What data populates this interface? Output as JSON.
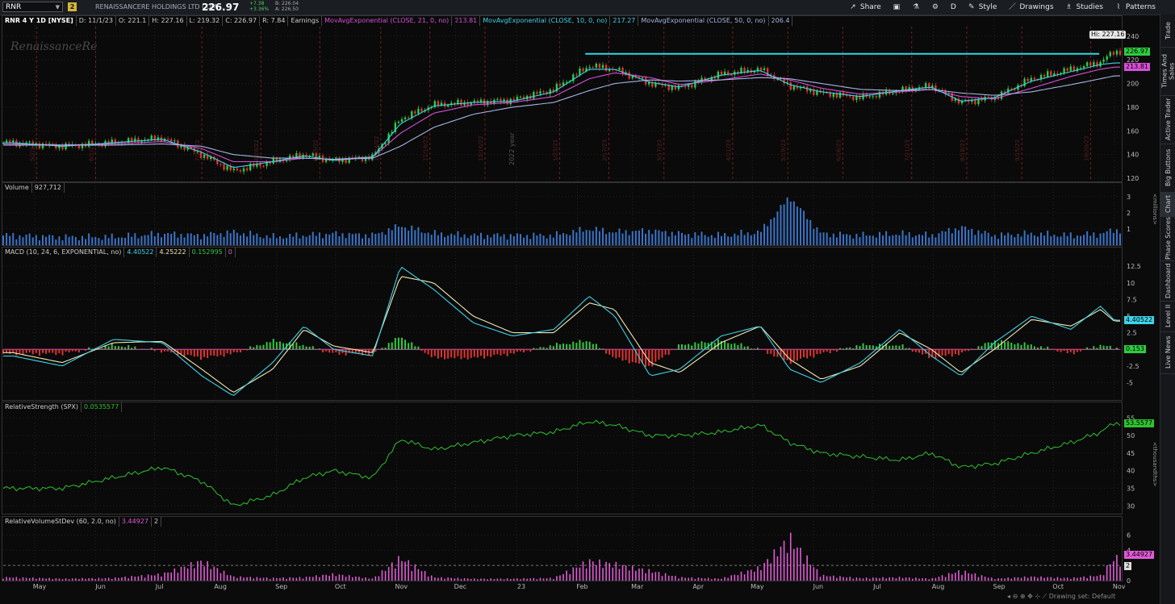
{
  "toolbar": {
    "symbol": "RNR",
    "link_number": "2",
    "company": "RENAISSANCERE HOLDINGS LTD COM",
    "price": "226.97",
    "change": "+7.38",
    "change_pct": "+3.36%",
    "bid": "B: 226.04",
    "ask": "A: 226.50",
    "share": "Share",
    "style": "Style",
    "drawings": "Drawings",
    "studies": "Studies",
    "patterns": "Patterns",
    "interval": "D"
  },
  "sidebar": {
    "tabs": [
      "Trade",
      "Times And Sales",
      "Active Trader",
      "Big Buttons",
      "Chart",
      "Phase Scores",
      "Dashboard",
      "Level II",
      "Live News"
    ]
  },
  "colors": {
    "up": "#2ecc40",
    "down": "#e0342f",
    "ema21": "#d84fd8",
    "ema10": "#3fd3e8",
    "ema50": "#a4b6e6",
    "resistance": "#29d9e6",
    "rs": "#2fc12f",
    "rvsd": "#e05ad6",
    "macd_fast": "#3fd3e8",
    "macd_slow": "#f0e7b0",
    "zero_line": "#e058c8"
  },
  "price_pane": {
    "header": {
      "title": "RNR 4 Y 1D [NYSE]",
      "date": "D: 11/1/23",
      "open": "O: 221.1",
      "high": "H: 227.16",
      "low": "L: 219.32",
      "close": "C: 226.97",
      "range": "R: 7.84",
      "earnings": "Earnings",
      "ema21_label": "MovAvgExponential (CLOSE, 21, 0, no)",
      "ema21_value": "213.81",
      "ema10_label": "MovAvgExponential (CLOSE, 10, 0, no)",
      "ema10_value": "217.27",
      "ema50_label": "MovAvgExponential (CLOSE, 50, 0, no)",
      "ema50_value": "206.4"
    },
    "watermark": "RenaissanceRe",
    "hi_label": "Hi: 227.16",
    "last_badge": "226.97",
    "ema21_badge": "213.81",
    "year_marker": "2022 year",
    "earnings_dates": [
      "5/2/22",
      "6/1/22",
      "7/25/22",
      "8/24/22",
      "9/23/22",
      "10/24/22",
      "11/18/22",
      "12/16/22",
      "1/23/23",
      "2/17/23",
      "3/17/23",
      "4/21/23",
      "5/19/23",
      "6/16/23",
      "7/21/23",
      "8/18/23",
      "9/15/23",
      "10/20/23"
    ]
  },
  "volume_pane": {
    "label": "Volume",
    "value": "927,712",
    "unit": "<millions>"
  },
  "macd_pane": {
    "label": "MACD (10, 24, 6, EXPONENTIAL, no)",
    "v1": "4.40522",
    "v2": "4.25222",
    "v3": "0.152995",
    "v4": "0",
    "badge_macd": "4.40522",
    "badge_hist": "0.153"
  },
  "rs_pane": {
    "label": "RelativeStrength (SPX)",
    "value": "0.0535577",
    "badge": "53.5577",
    "unit": "<thousandths>"
  },
  "rvsd_pane": {
    "label": "RelativeVolumeStDev (60, 2.0, no)",
    "value": "3.44927",
    "extra": "2",
    "badge": "3.44927",
    "badge2": "2"
  },
  "bottom_nav": "Drawing set: Default",
  "chart_data": {
    "type": "line",
    "title": "RNR 4 Y 1D [NYSE]",
    "x_ticks": [
      "May",
      "Jun",
      "Jul",
      "Aug",
      "Sep",
      "Oct",
      "Nov",
      "Dec",
      "23",
      "Feb",
      "Mar",
      "Apr",
      "May",
      "Jun",
      "Jul",
      "Aug",
      "Sep",
      "Oct",
      "Nov"
    ],
    "x": [
      "2022-04-20",
      "2022-05-15",
      "2022-06-10",
      "2022-07-05",
      "2022-07-25",
      "2022-08-10",
      "2022-08-30",
      "2022-09-15",
      "2022-09-30",
      "2022-10-20",
      "2022-11-03",
      "2022-11-20",
      "2022-12-10",
      "2022-12-30",
      "2023-01-20",
      "2023-02-07",
      "2023-02-20",
      "2023-03-10",
      "2023-03-25",
      "2023-04-15",
      "2023-05-05",
      "2023-05-20",
      "2023-06-05",
      "2023-06-25",
      "2023-07-15",
      "2023-07-31",
      "2023-08-15",
      "2023-09-01",
      "2023-09-20",
      "2023-10-10",
      "2023-10-25",
      "2023-11-01"
    ],
    "series": [
      {
        "name": "Price",
        "values": [
          150,
          147,
          150,
          154,
          140,
          126,
          134,
          140,
          135,
          138,
          170,
          182,
          184,
          186,
          195,
          215,
          212,
          200,
          196,
          208,
          212,
          198,
          192,
          188,
          194,
          198,
          184,
          188,
          204,
          212,
          218,
          226.97
        ]
      },
      {
        "name": "MovAvgExponential (CLOSE, 21, 0, no)",
        "values": [
          149,
          148,
          149,
          151,
          145,
          134,
          134,
          137,
          136,
          138,
          158,
          175,
          182,
          184,
          189,
          204,
          209,
          205,
          199,
          203,
          208,
          203,
          196,
          191,
          193,
          195,
          189,
          187,
          196,
          206,
          212,
          213.81
        ]
      },
      {
        "name": "MovAvgExponential (CLOSE, 10, 0, no)",
        "values": [
          150,
          147,
          150,
          153,
          142,
          129,
          134,
          139,
          135,
          138,
          166,
          181,
          184,
          185,
          193,
          212,
          212,
          201,
          197,
          207,
          211,
          199,
          193,
          189,
          194,
          197,
          185,
          188,
          202,
          210,
          216,
          217.27
        ]
      },
      {
        "name": "MovAvgExponential (CLOSE, 50, 0, no)",
        "values": [
          148,
          148,
          148,
          149,
          147,
          140,
          137,
          137,
          136,
          137,
          147,
          163,
          174,
          180,
          184,
          194,
          200,
          203,
          202,
          203,
          205,
          204,
          200,
          195,
          194,
          195,
          192,
          190,
          193,
          199,
          204,
          206.4
        ]
      }
    ],
    "ylim": [
      118,
      248
    ],
    "y_ticks": [
      120,
      140,
      160,
      180,
      200,
      220,
      240
    ],
    "resistance_level": 225,
    "macd": {
      "ylim": [
        -7.5,
        13.5
      ],
      "y_ticks": [
        -5,
        -2.5,
        0,
        2.5,
        5,
        7.5,
        10,
        12.5
      ],
      "macd": [
        -1,
        -2.5,
        1.5,
        1,
        -4,
        -7,
        -2,
        3.5,
        0,
        -1,
        12.5,
        9,
        4,
        2,
        3,
        8,
        5,
        -4,
        -3,
        2,
        3.5,
        -3,
        -5,
        -2,
        3,
        -1,
        -4,
        1,
        5,
        3,
        6.5,
        4.4
      ],
      "signal": [
        -0.5,
        -2,
        1,
        1.2,
        -3,
        -6.5,
        -3,
        3,
        0.5,
        -0.5,
        11,
        10,
        5,
        2.5,
        2.5,
        7,
        6,
        -2,
        -3.5,
        1,
        3.5,
        -1.5,
        -4.5,
        -2.5,
        2.5,
        0,
        -3.5,
        0,
        4.5,
        3.5,
        6,
        4.25
      ]
    },
    "relative_strength": {
      "ylim": [
        28,
        56
      ],
      "y_ticks": [
        30,
        35,
        40,
        45,
        50,
        55
      ],
      "values": [
        35,
        35,
        38,
        41,
        37,
        30,
        33,
        38,
        40,
        38,
        49,
        46,
        48,
        50,
        51,
        54,
        53,
        50,
        50,
        51,
        53,
        48,
        45,
        44,
        43,
        45,
        41,
        42,
        45,
        48,
        51,
        53.56
      ]
    },
    "volume": {
      "ylim": [
        0,
        3.2
      ],
      "y_ticks": [
        1,
        2,
        3
      ],
      "values": [
        0.6,
        0.5,
        0.5,
        0.7,
        0.6,
        0.8,
        0.5,
        0.6,
        0.7,
        0.6,
        1.2,
        0.7,
        0.6,
        0.6,
        0.6,
        1.0,
        0.8,
        0.9,
        0.7,
        0.6,
        0.8,
        3.0,
        0.7,
        0.6,
        0.7,
        0.6,
        1.1,
        0.6,
        0.7,
        0.6,
        0.7,
        0.93
      ]
    },
    "rvsd": {
      "ylim": [
        0,
        6.8
      ],
      "y_ticks": [
        0,
        2,
        4,
        6
      ],
      "values": [
        0.5,
        0.3,
        0.4,
        1.0,
        3.0,
        0.6,
        0.4,
        0.5,
        1.0,
        0.3,
        3.5,
        0.5,
        0.3,
        0.3,
        0.4,
        3.0,
        2.5,
        1.5,
        0.5,
        0.3,
        2.0,
        6.5,
        0.8,
        0.4,
        0.5,
        0.3,
        1.5,
        0.3,
        0.6,
        0.4,
        0.8,
        3.45
      ]
    }
  }
}
